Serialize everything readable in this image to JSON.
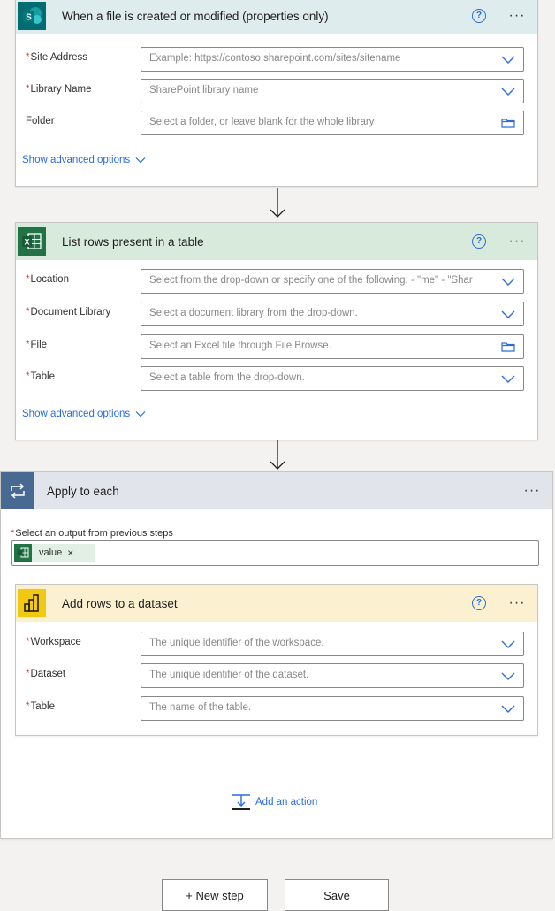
{
  "trigger": {
    "title": "When a file is created or modified (properties only)",
    "fields": [
      {
        "label": "Site Address",
        "placeholder": "Example: https://contoso.sharepoint.com/sites/sitename"
      },
      {
        "label": "Library Name",
        "placeholder": "SharePoint library name"
      },
      {
        "label": "Folder",
        "placeholder": "Select a folder, or leave blank for the whole library"
      }
    ],
    "advanced_label": "Show advanced options"
  },
  "list_rows": {
    "title": "List rows present in a table",
    "fields": [
      {
        "label": "Location",
        "placeholder": "Select from the drop-down or specify one of the following: - \"me\" - \"Shar"
      },
      {
        "label": "Document Library",
        "placeholder": "Select a document library from the drop-down."
      },
      {
        "label": "File",
        "placeholder": "Select an Excel file through File Browse."
      },
      {
        "label": "Table",
        "placeholder": "Select a table from the drop-down."
      }
    ],
    "advanced_label": "Show advanced options"
  },
  "apply_each": {
    "title": "Apply to each",
    "output_label": "Select an output from previous steps",
    "token_label": "value",
    "token_remove": "×"
  },
  "add_rows": {
    "title": "Add rows to a dataset",
    "fields": [
      {
        "label": "Workspace",
        "placeholder": "The unique identifier of the workspace."
      },
      {
        "label": "Dataset",
        "placeholder": "The unique identifier of the dataset."
      },
      {
        "label": "Table",
        "placeholder": "The name of the table."
      }
    ],
    "add_action_label": "Add an action"
  },
  "common": {
    "required_mark": "*",
    "help_glyph": "?",
    "more_glyph": "···"
  },
  "footer": {
    "new_step_label": "+ New step",
    "save_label": "Save"
  },
  "colors": {
    "sharepoint_header": "#dfecee",
    "excel_header": "#d7eadb",
    "loop_header": "#e1e4ea",
    "powerbi_header": "#fbf1d1",
    "accent": "#2b6cd9"
  }
}
